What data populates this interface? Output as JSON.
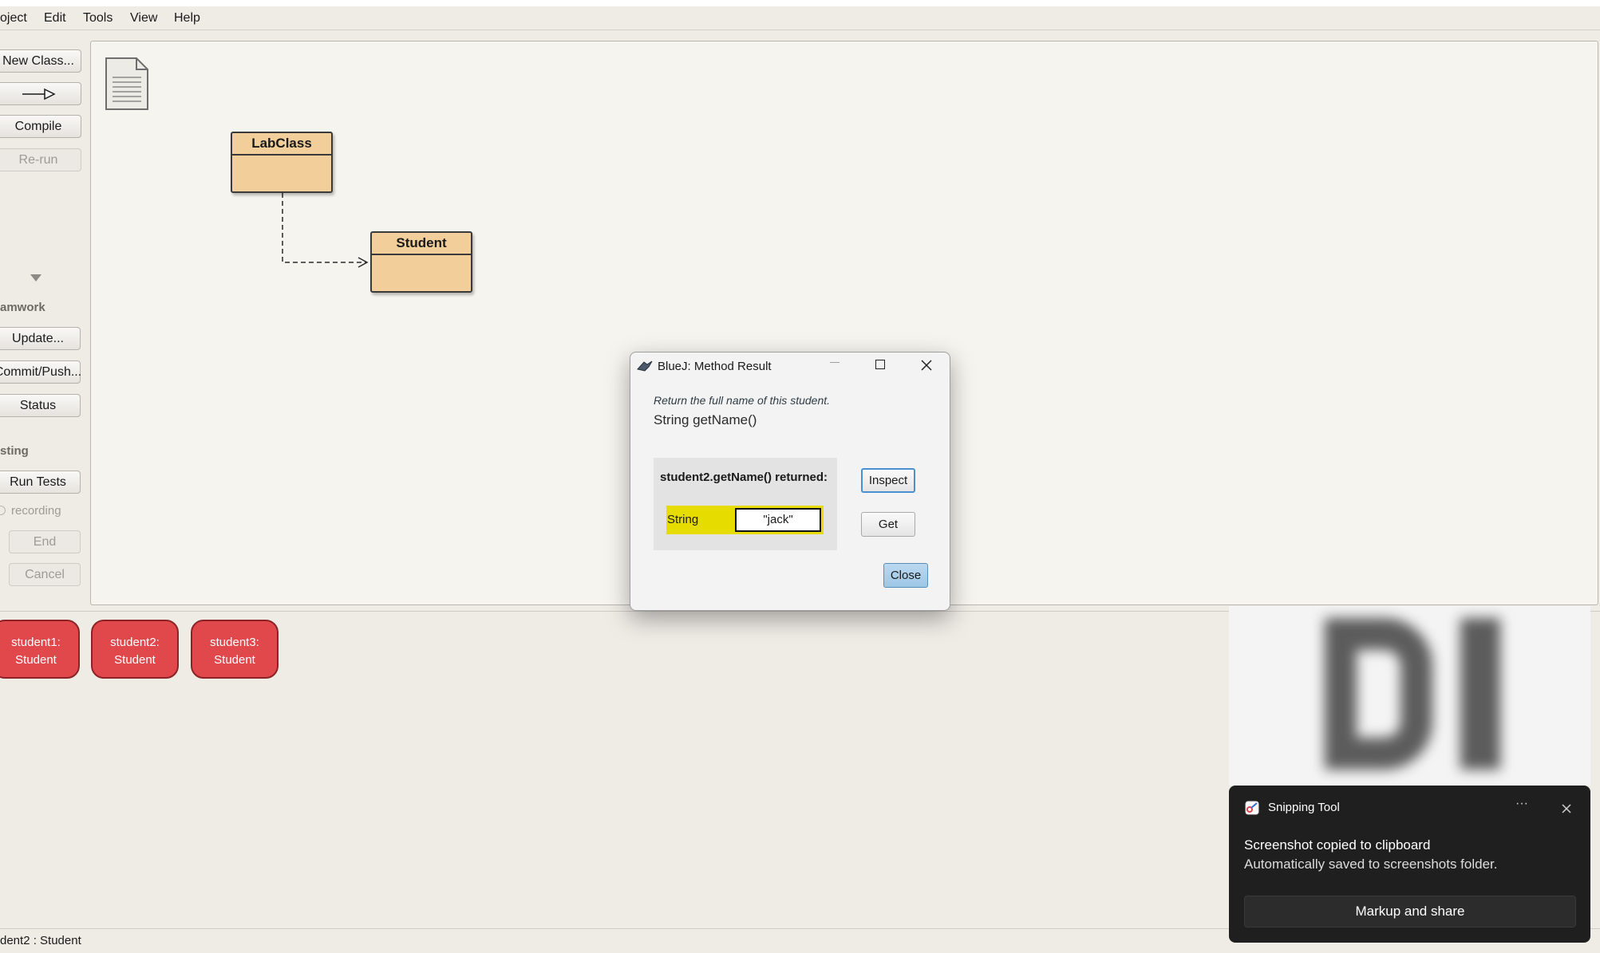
{
  "menu": {
    "items": [
      "oject",
      "Edit",
      "Tools",
      "View",
      "Help"
    ]
  },
  "toolbar": {
    "new_class": "New Class...",
    "compile": "Compile",
    "rerun": "Re-run",
    "teamwork_label": "amwork",
    "update": "Update...",
    "commit": "Commit/Push...",
    "status": "Status",
    "testing_label": "sting",
    "run_tests": "Run Tests",
    "recording": "recording",
    "end": "End",
    "cancel": "Cancel"
  },
  "diagram": {
    "classes": [
      {
        "name": "LabClass"
      },
      {
        "name": "Student"
      }
    ]
  },
  "object_bench": {
    "objects": [
      {
        "line1": "student1:",
        "line2": "Student"
      },
      {
        "line1": "student2:",
        "line2": "Student"
      },
      {
        "line1": "student3:",
        "line2": "Student"
      }
    ]
  },
  "status_bar": {
    "text": "dent2 : Student"
  },
  "dialog": {
    "title": "BlueJ:  Method Result",
    "comment": "Return the full name of this student.",
    "signature": "String getName()",
    "returned_label": "student2.getName() returned:",
    "type": "String",
    "value": "\"jack\"",
    "inspect": "Inspect",
    "get": "Get",
    "close": "Close"
  },
  "toast": {
    "app": "Snipping Tool",
    "more": "···",
    "title": "Screenshot copied to clipboard",
    "subtitle": "Automatically saved to screenshots folder.",
    "action": "Markup and share"
  },
  "colors": {
    "class_fill": "#f2cf9a",
    "object_fill": "#e1484c",
    "result_highlight": "#e6dc00",
    "toast_bg": "#1f1f1f"
  }
}
